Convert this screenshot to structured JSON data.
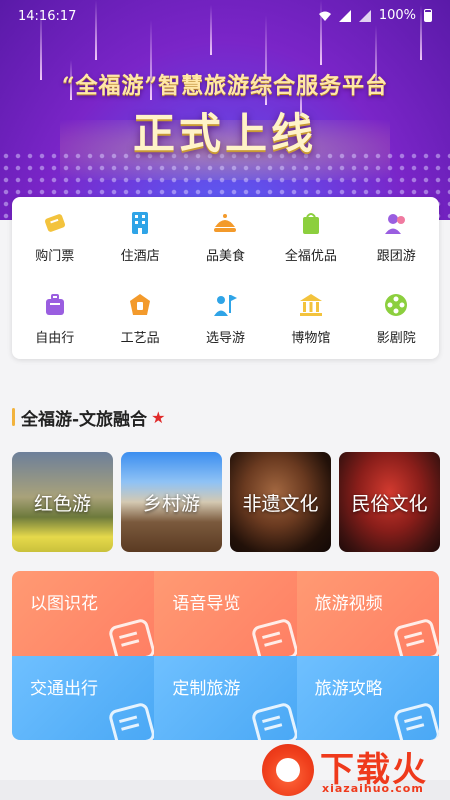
{
  "status_bar": {
    "time": "14:16:17",
    "battery": "100%"
  },
  "banner": {
    "title": "“全福游”智慧旅游综合服务平台",
    "headline": "正式上线"
  },
  "categories": [
    {
      "label": "购门票",
      "icon": "ticket-icon",
      "color": "#f3c33d"
    },
    {
      "label": "住酒店",
      "icon": "hotel-icon",
      "color": "#2fa4e7"
    },
    {
      "label": "品美食",
      "icon": "food-icon",
      "color": "#f39a2b"
    },
    {
      "label": "全福优品",
      "icon": "shopping-bag-icon",
      "color": "#8ccf3e"
    },
    {
      "label": "跟团游",
      "icon": "group-tour-icon",
      "color": "#9a5ee0"
    },
    {
      "label": "自由行",
      "icon": "luggage-icon",
      "color": "#9a5ee0"
    },
    {
      "label": "工艺品",
      "icon": "craft-icon",
      "color": "#f39a2b"
    },
    {
      "label": "选导游",
      "icon": "guide-flag-icon",
      "color": "#2fa4e7"
    },
    {
      "label": "博物馆",
      "icon": "museum-icon",
      "color": "#f3c33d"
    },
    {
      "label": "影剧院",
      "icon": "film-reel-icon",
      "color": "#8ccf3e"
    }
  ],
  "section": {
    "title": "全福游-文旅融合"
  },
  "tiles": [
    {
      "label": "红色游"
    },
    {
      "label": "乡村游"
    },
    {
      "label": "非遗文化"
    },
    {
      "label": "民俗文化"
    }
  ],
  "services": [
    {
      "label": "以图识花",
      "icon": "camera-icon",
      "tone": "warm"
    },
    {
      "label": "语音导览",
      "icon": "microphone-icon",
      "tone": "warm"
    },
    {
      "label": "旅游视频",
      "icon": "video-icon",
      "tone": "warm"
    },
    {
      "label": "交通出行",
      "icon": "car-icon",
      "tone": "cool"
    },
    {
      "label": "定制旅游",
      "icon": "suitcase-icon",
      "tone": "cool"
    },
    {
      "label": "旅游攻略",
      "icon": "guidebook-icon",
      "tone": "cool"
    }
  ],
  "watermark": {
    "text": "下载火",
    "url": "xiazaihuo.com"
  }
}
